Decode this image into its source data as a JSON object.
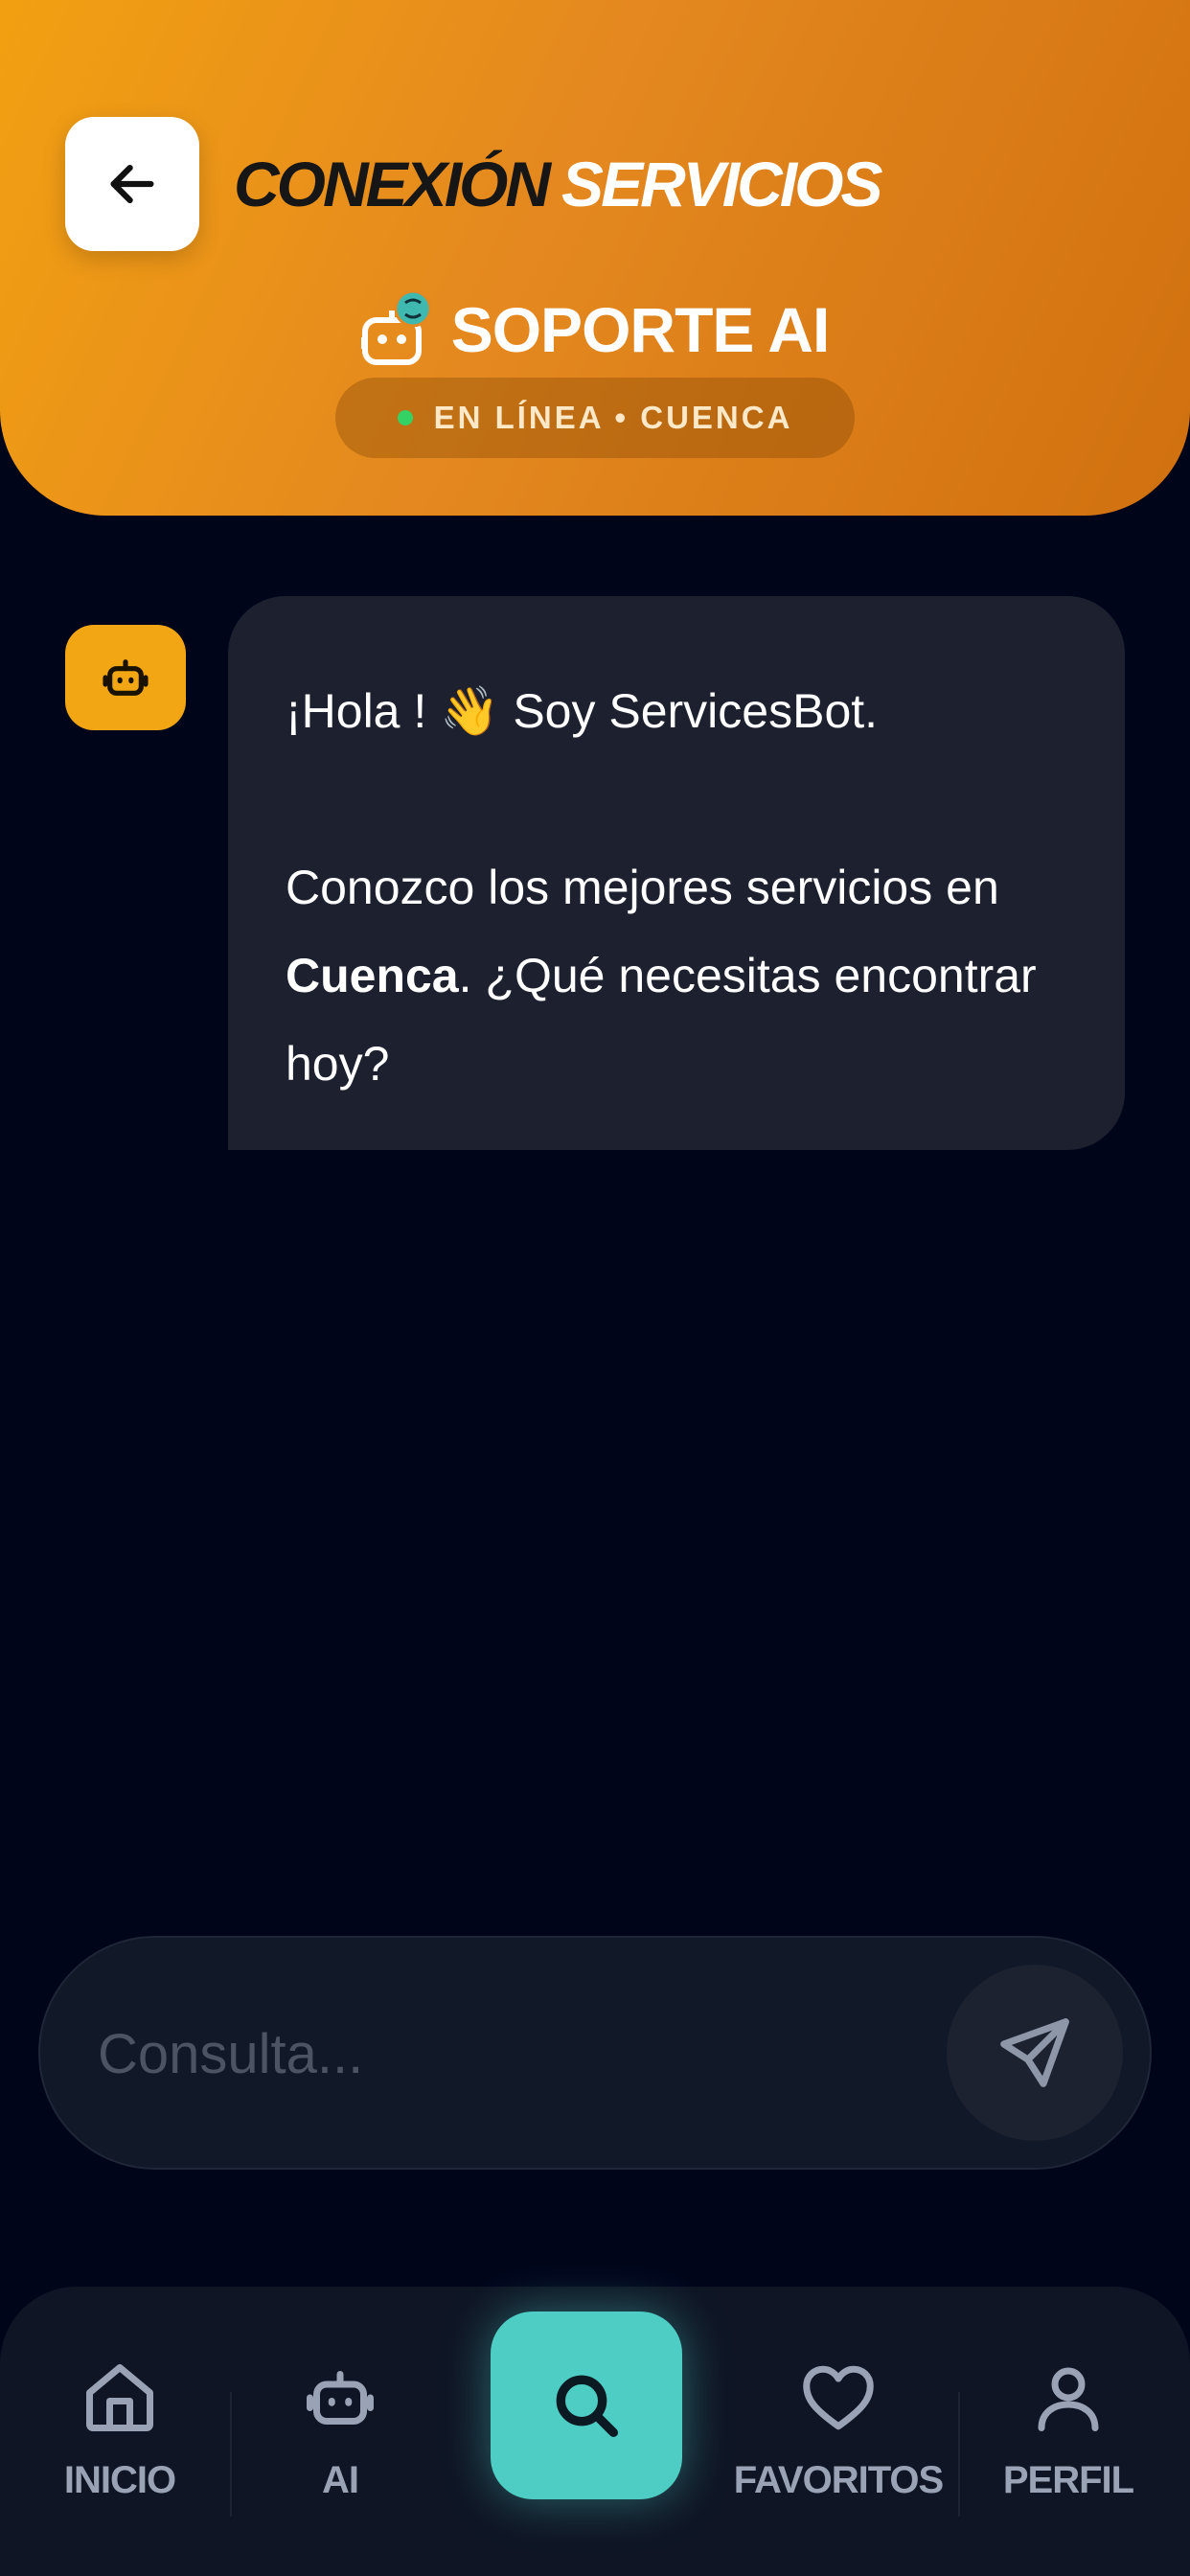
{
  "header": {
    "back_label": "back",
    "brand_part1": "CONEXIÓN",
    "brand_part2": "SERVICIOS",
    "title": "SOPORTE AI",
    "status": "EN LÍNEA • CUENCA",
    "gradient_start": "#f2a012",
    "gradient_end": "#d0700f"
  },
  "chat": {
    "messages": [
      {
        "sender": "bot",
        "line1_prefix": "¡Hola ! ",
        "emoji": "👋",
        "line1_suffix": " Soy ServicesBot.",
        "para2_prefix": "Conozco los mejores servicios en ",
        "para2_bold": "Cuenca",
        "para2_suffix": ". ¿Qué necesitas encontrar hoy?"
      }
    ]
  },
  "input": {
    "placeholder": "Consulta...",
    "value": ""
  },
  "nav": {
    "items": [
      {
        "label": "INICIO",
        "icon": "home-icon"
      },
      {
        "label": "AI",
        "icon": "robot-icon"
      },
      {
        "label": "",
        "icon": "search-icon"
      },
      {
        "label": "FAVORITOS",
        "icon": "heart-icon"
      },
      {
        "label": "PERFIL",
        "icon": "user-icon"
      }
    ],
    "accent": "#4ecdc4"
  },
  "colors": {
    "background": "#01051a",
    "bubble": "#1d212f",
    "bot_avatar": "#f2a614",
    "status_dot": "#34d164"
  }
}
